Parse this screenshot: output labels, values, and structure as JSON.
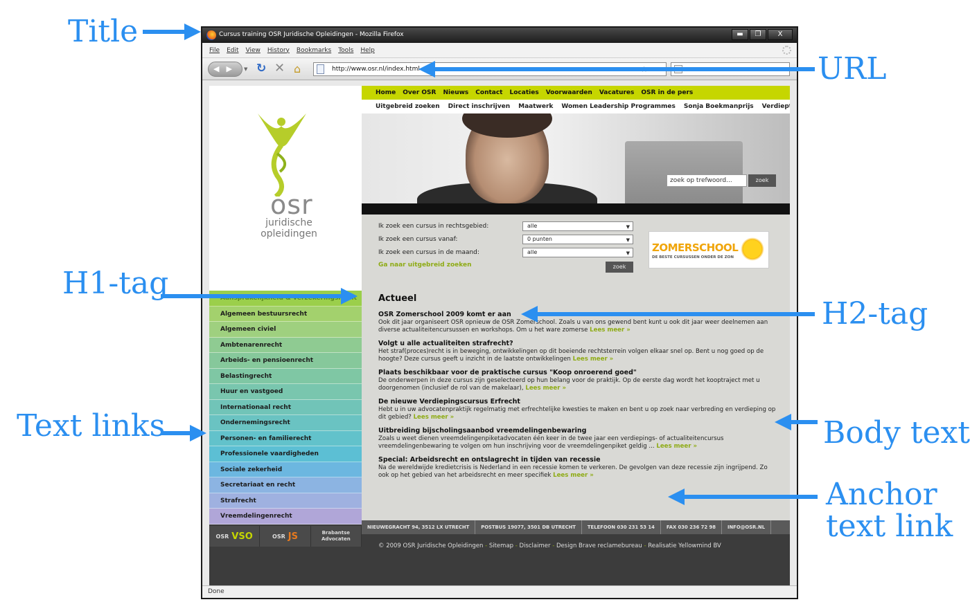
{
  "annotations": {
    "title": "Title",
    "url": "URL",
    "h1": "H1-tag",
    "h2": "H2-tag",
    "text_links": "Text links",
    "body_text": "Body text",
    "anchor_line1": "Anchor",
    "anchor_line2": "text link"
  },
  "browser": {
    "title": "Cursus training OSR Juridische Opleidingen - Mozilla Firefox",
    "menu": [
      "File",
      "Edit",
      "View",
      "History",
      "Bookmarks",
      "Tools",
      "Help"
    ],
    "url": "http://www.osr.nl/index.html",
    "status": "Done",
    "window_buttons": [
      "▬",
      "❐",
      "X"
    ]
  },
  "logo": {
    "name": "osr",
    "sub1": "juridische",
    "sub2": "opleidingen"
  },
  "topnav": [
    "Home",
    "Over OSR",
    "Nieuws",
    "Contact",
    "Locaties",
    "Voorwaarden",
    "Vacatures",
    "OSR in de pers"
  ],
  "subnav": [
    "Uitgebreid zoeken",
    "Direct inschrijven",
    "Maatwerk",
    "Women Leadership Programmes",
    "Sonja Boekmanprijs",
    "Verdiept"
  ],
  "hero_search": {
    "placeholder": "zoek op trefwoord...",
    "button": "zoek"
  },
  "search_form": {
    "label1": "Ik zoek een cursus in rechtsgebied:",
    "value1": "alle",
    "label2": "Ik zoek een cursus vanaf:",
    "value2": "0 punten",
    "label3": "Ik zoek een cursus in de maand:",
    "value3": "alle",
    "advanced_link": "Ga naar uitgebreid zoeken",
    "button": "zoek"
  },
  "zomerschool": {
    "title": "ZOMERSCHOOL",
    "subtitle": "DE BESTE CURSUSSEN ONDER DE ZON"
  },
  "rechtsgebieden": [
    "Aansprakelijkheid & verzekeringsrecht",
    "Algemeen bestuursrecht",
    "Algemeen civiel",
    "Ambtenarenrecht",
    "Arbeids- en pensioenrecht",
    "Belastingrecht",
    "Huur en vastgoed",
    "Internationaal recht",
    "Ondernemingsrecht",
    "Personen- en familierecht",
    "Professionele vaardigheden",
    "Sociale zekerheid",
    "Secretariaat en recht",
    "Strafrecht",
    "Vreemdelingenrecht"
  ],
  "rg_colors": [
    "#9bcf4b",
    "#a3d16d",
    "#9fd07f",
    "#8fcb92",
    "#86c89b",
    "#7fc7a4",
    "#79c6ae",
    "#71c4b8",
    "#6ac3c2",
    "#62c2cb",
    "#5cbfd4",
    "#6cb7e0",
    "#8cb4e2",
    "#9fb1e0",
    "#b0a6d8"
  ],
  "brands": {
    "vso_prefix": "OSR",
    "vso": "VSO",
    "js_prefix": "OSR",
    "js": "JS",
    "ba1": "Brabantse",
    "ba2": "Advocaten"
  },
  "news": {
    "heading": "Actueel",
    "read_more": "Lees meer »",
    "items": [
      {
        "title": "OSR Zomerschool 2009 komt er aan",
        "body": "Ook dit jaar organiseert OSR opnieuw de OSR Zomerschool. Zoals u van ons gewend bent kunt u ook dit jaar weer deelnemen aan diverse actualiteitencursussen en workshops. Om u het ware zomerse"
      },
      {
        "title": "Volgt u alle actualiteiten strafrecht?",
        "body": "Het straf(proces)recht is in beweging, ontwikkelingen op dit boeiende rechtsterrein volgen elkaar snel op. Bent u nog goed op de hoogte? Deze cursus geeft u inzicht in de laatste ontwikkelingen"
      },
      {
        "title": "Plaats beschikbaar voor de praktische cursus \"Koop onroerend goed\"",
        "body": "De onderwerpen in deze cursus zijn geselecteerd op hun belang voor de praktijk. Op de eerste dag wordt het kooptraject met u doorgenomen (inclusief de rol van de makelaar),"
      },
      {
        "title": "De nieuwe Verdiepingscursus Erfrecht",
        "body": "Hebt u in uw advocatenpraktijk regelmatig met erfrechtelijke kwesties te maken en bent u op zoek naar verbreding en verdieping op dit gebied?"
      },
      {
        "title": "Uitbreiding bijscholingsaanbod vreemdelingenbewaring",
        "body": "Zoals u weet dienen vreemdelingenpiketadvocaten één keer in de twee jaar een verdiepings- of actualiteitencursus vreemdelingenbewaring te volgen om hun inschrijving voor de vreemdelingenpiket geldig ..."
      },
      {
        "title": "Special: Arbeidsrecht en ontslagrecht in tijden van recessie",
        "body": "Na de wereldwijde kredietcrisis is Nederland in een recessie komen te verkeren. De gevolgen van deze recessie zijn ingrijpend. Zo ook op het gebied van het arbeidsrecht en meer specifiek"
      }
    ]
  },
  "footer": {
    "address": "NIEUWEGRACHT 94, 3512 LX UTRECHT",
    "postbus": "POSTBUS 19077, 3501 DB UTRECHT",
    "phone": "TELEFOON 030 231 53 14",
    "fax": "FAX 030 236 72 98",
    "email": "INFO@OSR.NL",
    "copyright": "© 2009 OSR Juridische Opleidingen",
    "links": [
      "Sitemap",
      "Disclaimer",
      "Design Brave reclamebureau",
      "Realisatie Yellowmind BV"
    ],
    "separator": "-"
  },
  "colors": {
    "annotation": "#2b8ff0",
    "lime": "#c6d600",
    "link_green": "#8eab15"
  }
}
